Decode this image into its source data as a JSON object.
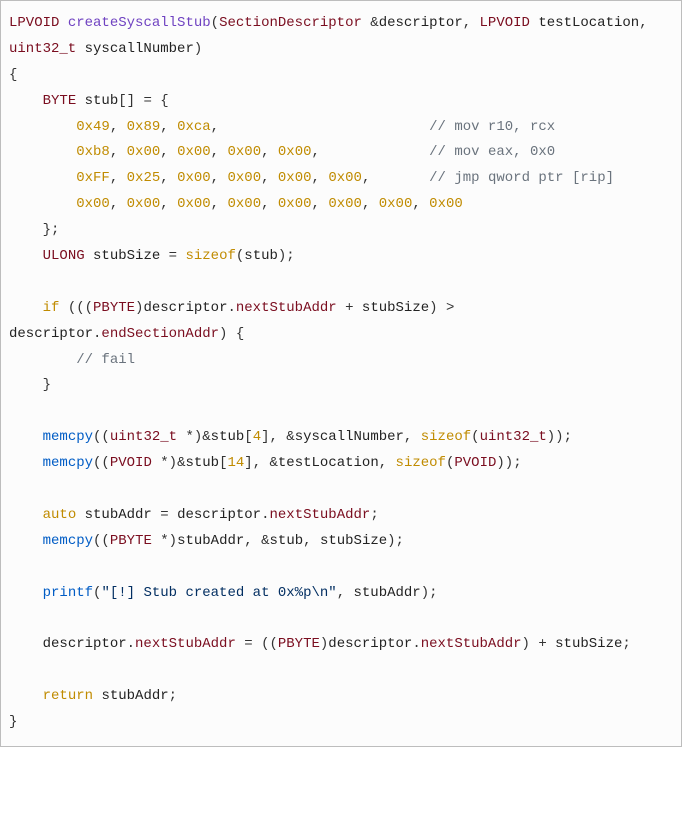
{
  "l1": {
    "ret": "LPVOID",
    "fn": "createSyscallStub",
    "p1t": "SectionDescriptor",
    "amp": "&",
    "p1n": "descriptor",
    "c": ",",
    "p2t": "LPVOID",
    "p2n": "testLocation",
    "p3t": "uint32_t",
    "p3n": "syscallNumber",
    "rp": ")"
  },
  "l2": {
    "brace": "{"
  },
  "l3": {
    "indent": "    ",
    "type": "BYTE",
    "sp": " ",
    "name": "stub",
    "br": "[]",
    "eq": " = {",
    "op": ""
  },
  "l4": {
    "h0": "0x49",
    "h1": "0x89",
    "h2": "0xca",
    "c": ",",
    "cmt": "// mov r10, rcx"
  },
  "l5": {
    "h0": "0xb8",
    "h1": "0x00",
    "h2": "0x00",
    "h3": "0x00",
    "h4": "0x00",
    "c": ",",
    "cmt": "// mov eax, 0x0"
  },
  "l6": {
    "h0": "0xFF",
    "h1": "0x25",
    "h2": "0x00",
    "h3": "0x00",
    "h4": "0x00",
    "h5": "0x00",
    "c": ",",
    "cmt": "// jmp qword ptr",
    "cmt2": "[rip]"
  },
  "l7": {
    "h0": "0x00",
    "h1": "0x00",
    "h2": "0x00",
    "h3": "0x00",
    "h4": "0x00",
    "h5": "0x00",
    "h6": "0x00",
    "h7": "0x00",
    "c": ","
  },
  "l8": {
    "close": "    };"
  },
  "l9": {
    "type": "ULONG",
    "name": "stubSize",
    "eq": " = ",
    "szof": "sizeof",
    "arg": "stub",
    "end": ");"
  },
  "l10": {
    "kw": "if",
    "open": " (((",
    "cast": "PBYTE",
    "rp1": ")",
    "d": "descriptor",
    "dot": ".",
    "m1": "nextStubAddr",
    "plus": " + ",
    "sz": "stubSize",
    "rp2": ") > ",
    "d2": "descriptor",
    "m2": "endSectionAddr",
    "rp3": ") {"
  },
  "l11": {
    "cmt": "// fail"
  },
  "l12": {
    "close": "    }"
  },
  "l13": {
    "fn": "memcpy",
    "op": "((",
    "cast": "uint32_t",
    "star": " *)&",
    "arr": "stub",
    "lb": "[",
    "idx": "4",
    "rb": "], &",
    "arg2": "syscallNumber",
    "c2": ", ",
    "szof": "sizeof",
    "lp": "(",
    "sztype": "uint32_t",
    "end": "));"
  },
  "l14": {
    "fn": "memcpy",
    "op": "((",
    "cast": "PVOID",
    "star": " *)&",
    "arr": "stub",
    "lb": "[",
    "idx": "14",
    "rb": "], &",
    "arg2": "testLocation",
    "c2": ", ",
    "szof": "sizeof",
    "lp": "(",
    "sztype": "PVOID",
    "end": "));"
  },
  "l15": {
    "auto": "auto",
    "name": "stubAddr",
    "eq": " = ",
    "d": "descriptor",
    "dot": ".",
    "m": "nextStubAddr",
    "end": ";"
  },
  "l16": {
    "fn": "memcpy",
    "op": "((",
    "cast": "PBYTE",
    "star": " *)",
    "a1": "stubAddr",
    "c1": ", &",
    "a2": "stub",
    "c2": ", ",
    "a3": "stubSize",
    "end": ");"
  },
  "l17": {
    "fn": "printf",
    "lp": "(",
    "str": "\"[!] Stub created at 0x%p\\n\"",
    "c": ", ",
    "arg": "stubAddr",
    "end": ");"
  },
  "l18": {
    "d": "descriptor",
    "dot": ".",
    "m": "nextStubAddr",
    "eq": " = ((",
    "cast": "PBYTE",
    "rp": ")",
    "d2": "descriptor",
    "m2": "nextStubAddr",
    "rp2": ") + ",
    "sz": "stubSize",
    "end": ";"
  },
  "l19": {
    "kw": "return",
    "sp": " ",
    "name": "stubAddr",
    "end": ";"
  },
  "l20": {
    "brace": "}"
  }
}
